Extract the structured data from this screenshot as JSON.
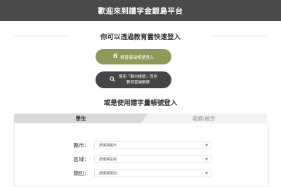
{
  "header": {
    "title": "歡迎來到譜字金銀島平台"
  },
  "cloud_login": {
    "title": "你可以透過教育雲快速登入",
    "primary_button": {
      "icon": "openid-icon",
      "label": "教育雲端帳號登入"
    },
    "city_button": {
      "icon": "search-icon",
      "line1": "使用「縣市帳號」而非",
      "line2": "教育雲端帳號"
    }
  },
  "account_login": {
    "title": "或是使用譜字量帳號登入"
  },
  "tabs": [
    {
      "label": "學生",
      "active": true
    },
    {
      "label": "老師/校方",
      "active": false
    }
  ],
  "form": {
    "fields": [
      {
        "label": "縣市：",
        "value": "請選擇縣市"
      },
      {
        "label": "區域：",
        "value": "請選擇區域"
      },
      {
        "label": "類別：",
        "value": "請選擇類別"
      }
    ]
  },
  "colors": {
    "header_bg": "#4a4a4a",
    "primary_button": "#8f9a5a",
    "secondary_button": "#454545",
    "active_tab": "#d9d9d9",
    "inactive_tab": "#f2f2f2"
  }
}
